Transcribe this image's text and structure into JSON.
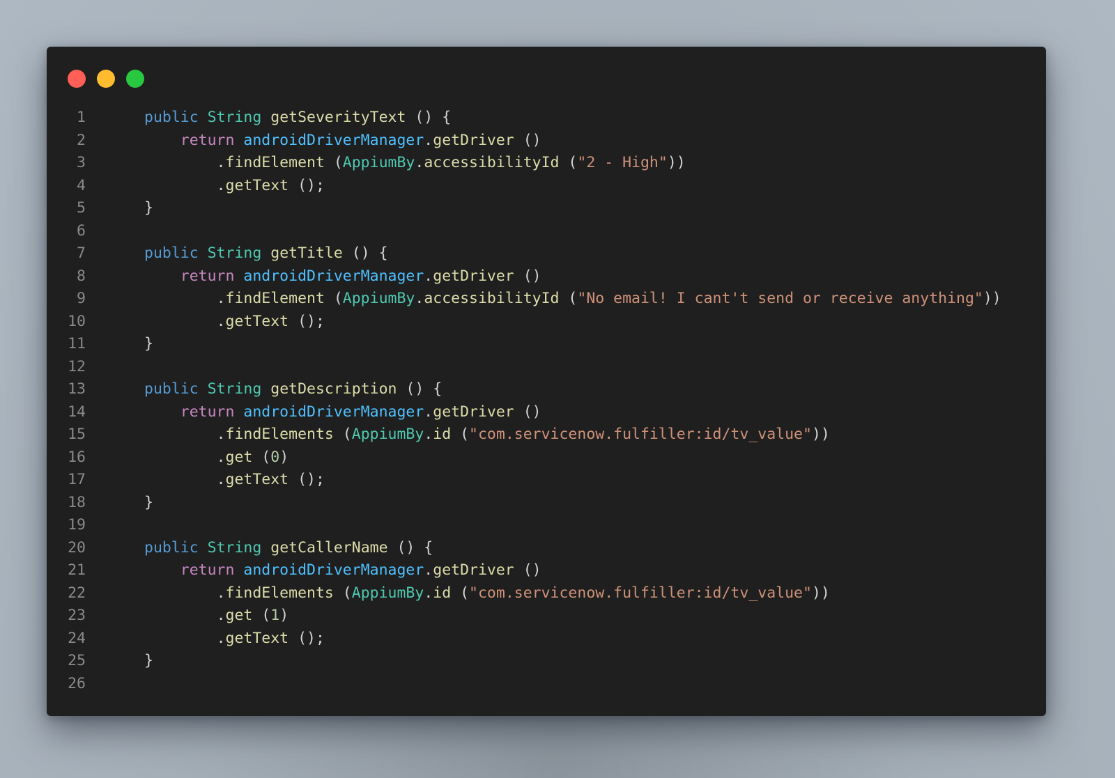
{
  "window": {
    "traffic_lights": [
      {
        "name": "close",
        "color": "#ff5f57"
      },
      {
        "name": "minimize",
        "color": "#febc2e"
      },
      {
        "name": "maximize",
        "color": "#28c840"
      }
    ]
  },
  "theme": {
    "keyword": "#569cd6",
    "control": "#c586c0",
    "type": "#4ec9b0",
    "function": "#dcdcaa",
    "variable": "#4fc1ff",
    "string": "#ce9178",
    "number": "#b5cea8",
    "punctuation": "#d4d4d4",
    "line_number": "#8a8a8a",
    "background": "#1f1f1f"
  },
  "code": {
    "language": "java",
    "lines": [
      {
        "n": "1",
        "indent": 0,
        "tokens": [
          [
            "keyword",
            "public"
          ],
          [
            "punct",
            " "
          ],
          [
            "type",
            "String"
          ],
          [
            "punct",
            " "
          ],
          [
            "func",
            "getSeverityText"
          ],
          [
            "punct",
            " () {"
          ]
        ]
      },
      {
        "n": "2",
        "indent": 1,
        "tokens": [
          [
            "control",
            "return"
          ],
          [
            "punct",
            " "
          ],
          [
            "var",
            "androidDriverManager"
          ],
          [
            "punct",
            "."
          ],
          [
            "func",
            "getDriver"
          ],
          [
            "punct",
            " ()"
          ]
        ]
      },
      {
        "n": "3",
        "indent": 2,
        "tokens": [
          [
            "punct",
            "."
          ],
          [
            "func",
            "findElement"
          ],
          [
            "punct",
            " ("
          ],
          [
            "type",
            "AppiumBy"
          ],
          [
            "punct",
            "."
          ],
          [
            "func",
            "accessibilityId"
          ],
          [
            "punct",
            " ("
          ],
          [
            "string",
            "\"2 - High\""
          ],
          [
            "punct",
            "))"
          ]
        ]
      },
      {
        "n": "4",
        "indent": 2,
        "tokens": [
          [
            "punct",
            "."
          ],
          [
            "func",
            "getText"
          ],
          [
            "punct",
            " ();"
          ]
        ]
      },
      {
        "n": "5",
        "indent": 0,
        "tokens": [
          [
            "punct",
            "}"
          ]
        ]
      },
      {
        "n": "6",
        "indent": 0,
        "tokens": []
      },
      {
        "n": "7",
        "indent": 0,
        "tokens": [
          [
            "keyword",
            "public"
          ],
          [
            "punct",
            " "
          ],
          [
            "type",
            "String"
          ],
          [
            "punct",
            " "
          ],
          [
            "func",
            "getTitle"
          ],
          [
            "punct",
            " () {"
          ]
        ]
      },
      {
        "n": "8",
        "indent": 1,
        "tokens": [
          [
            "control",
            "return"
          ],
          [
            "punct",
            " "
          ],
          [
            "var",
            "androidDriverManager"
          ],
          [
            "punct",
            "."
          ],
          [
            "func",
            "getDriver"
          ],
          [
            "punct",
            " ()"
          ]
        ]
      },
      {
        "n": "9",
        "indent": 2,
        "tokens": [
          [
            "punct",
            "."
          ],
          [
            "func",
            "findElement"
          ],
          [
            "punct",
            " ("
          ],
          [
            "type",
            "AppiumBy"
          ],
          [
            "punct",
            "."
          ],
          [
            "func",
            "accessibilityId"
          ],
          [
            "punct",
            " ("
          ],
          [
            "string",
            "\"No email! I cant't send or receive anything\""
          ],
          [
            "punct",
            "))"
          ]
        ]
      },
      {
        "n": "10",
        "indent": 2,
        "tokens": [
          [
            "punct",
            "."
          ],
          [
            "func",
            "getText"
          ],
          [
            "punct",
            " ();"
          ]
        ]
      },
      {
        "n": "11",
        "indent": 0,
        "tokens": [
          [
            "punct",
            "}"
          ]
        ]
      },
      {
        "n": "12",
        "indent": 0,
        "tokens": []
      },
      {
        "n": "13",
        "indent": 0,
        "tokens": [
          [
            "keyword",
            "public"
          ],
          [
            "punct",
            " "
          ],
          [
            "type",
            "String"
          ],
          [
            "punct",
            " "
          ],
          [
            "func",
            "getDescription"
          ],
          [
            "punct",
            " () {"
          ]
        ]
      },
      {
        "n": "14",
        "indent": 1,
        "tokens": [
          [
            "control",
            "return"
          ],
          [
            "punct",
            " "
          ],
          [
            "var",
            "androidDriverManager"
          ],
          [
            "punct",
            "."
          ],
          [
            "func",
            "getDriver"
          ],
          [
            "punct",
            " ()"
          ]
        ]
      },
      {
        "n": "15",
        "indent": 2,
        "tokens": [
          [
            "punct",
            "."
          ],
          [
            "func",
            "findElements"
          ],
          [
            "punct",
            " ("
          ],
          [
            "type",
            "AppiumBy"
          ],
          [
            "punct",
            "."
          ],
          [
            "func",
            "id"
          ],
          [
            "punct",
            " ("
          ],
          [
            "string",
            "\"com.servicenow.fulfiller:id/tv_value\""
          ],
          [
            "punct",
            "))"
          ]
        ]
      },
      {
        "n": "16",
        "indent": 2,
        "tokens": [
          [
            "punct",
            "."
          ],
          [
            "func",
            "get"
          ],
          [
            "punct",
            " ("
          ],
          [
            "number",
            "0"
          ],
          [
            "punct",
            ")"
          ]
        ]
      },
      {
        "n": "17",
        "indent": 2,
        "tokens": [
          [
            "punct",
            "."
          ],
          [
            "func",
            "getText"
          ],
          [
            "punct",
            " ();"
          ]
        ]
      },
      {
        "n": "18",
        "indent": 0,
        "tokens": [
          [
            "punct",
            "}"
          ]
        ]
      },
      {
        "n": "19",
        "indent": 0,
        "tokens": []
      },
      {
        "n": "20",
        "indent": 0,
        "tokens": [
          [
            "keyword",
            "public"
          ],
          [
            "punct",
            " "
          ],
          [
            "type",
            "String"
          ],
          [
            "punct",
            " "
          ],
          [
            "func",
            "getCallerName"
          ],
          [
            "punct",
            " () {"
          ]
        ]
      },
      {
        "n": "21",
        "indent": 1,
        "tokens": [
          [
            "control",
            "return"
          ],
          [
            "punct",
            " "
          ],
          [
            "var",
            "androidDriverManager"
          ],
          [
            "punct",
            "."
          ],
          [
            "func",
            "getDriver"
          ],
          [
            "punct",
            " ()"
          ]
        ]
      },
      {
        "n": "22",
        "indent": 2,
        "tokens": [
          [
            "punct",
            "."
          ],
          [
            "func",
            "findElements"
          ],
          [
            "punct",
            " ("
          ],
          [
            "type",
            "AppiumBy"
          ],
          [
            "punct",
            "."
          ],
          [
            "func",
            "id"
          ],
          [
            "punct",
            " ("
          ],
          [
            "string",
            "\"com.servicenow.fulfiller:id/tv_value\""
          ],
          [
            "punct",
            "))"
          ]
        ]
      },
      {
        "n": "23",
        "indent": 2,
        "tokens": [
          [
            "punct",
            "."
          ],
          [
            "func",
            "get"
          ],
          [
            "punct",
            " ("
          ],
          [
            "number",
            "1"
          ],
          [
            "punct",
            ")"
          ]
        ]
      },
      {
        "n": "24",
        "indent": 2,
        "tokens": [
          [
            "punct",
            "."
          ],
          [
            "func",
            "getText"
          ],
          [
            "punct",
            " ();"
          ]
        ]
      },
      {
        "n": "25",
        "indent": 0,
        "tokens": [
          [
            "punct",
            "}"
          ]
        ]
      },
      {
        "n": "26",
        "indent": 0,
        "tokens": []
      }
    ]
  }
}
